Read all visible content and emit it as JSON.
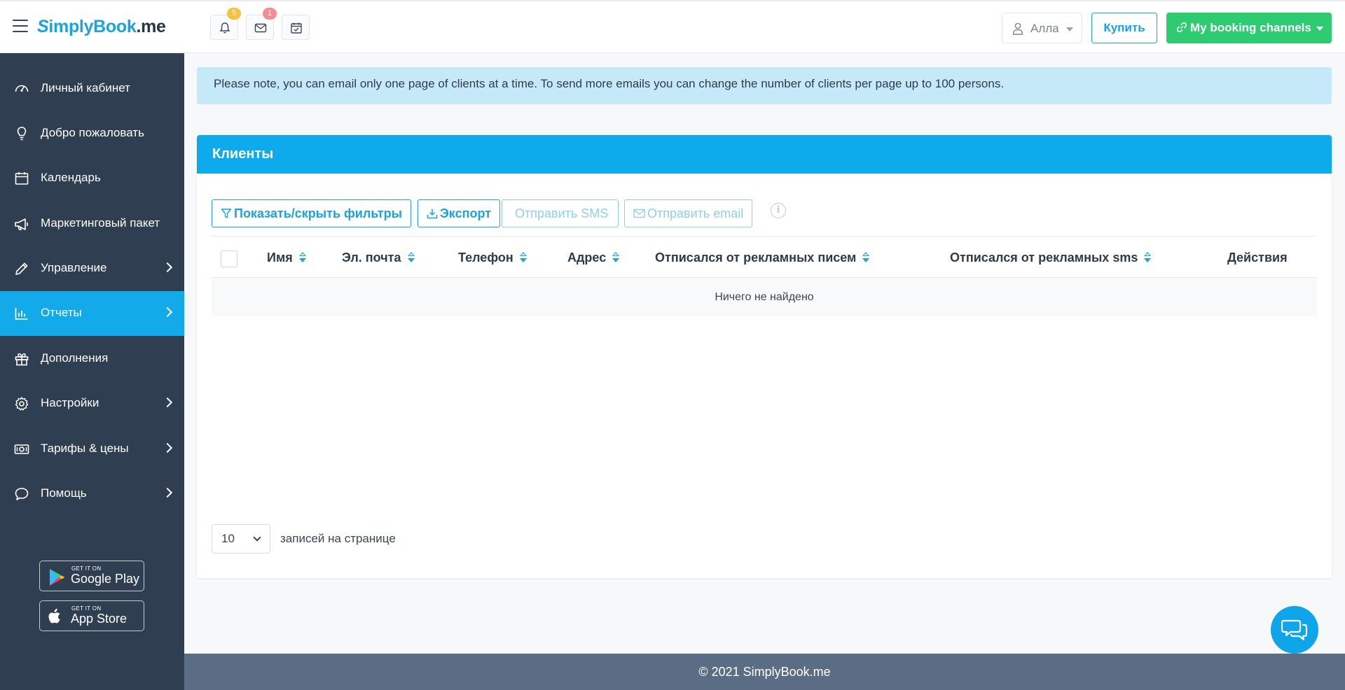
{
  "header": {
    "logo_s": "S",
    "logo_brand": "implyBook",
    "logo_tld": ".me",
    "notifications_badge": "5",
    "messages_badge": "1",
    "user_name": "Алла",
    "buy_label": "Купить",
    "channels_label": "My booking channels"
  },
  "sidebar": {
    "items": [
      {
        "label": "Личный кабинет",
        "icon": "dashboard-icon"
      },
      {
        "label": "Добро пожаловать",
        "icon": "lightbulb-icon"
      },
      {
        "label": "Календарь",
        "icon": "calendar-icon"
      },
      {
        "label": "Маркетинговый пакет",
        "icon": "megaphone-icon"
      },
      {
        "label": "Управление",
        "icon": "pencil-icon"
      },
      {
        "label": "Отчеты",
        "icon": "bar-chart-icon"
      },
      {
        "label": "Дополнения",
        "icon": "gift-icon"
      },
      {
        "label": "Настройки",
        "icon": "gear-icon"
      },
      {
        "label": "Тарифы & цены",
        "icon": "money-icon"
      },
      {
        "label": "Помощь",
        "icon": "chat-bubble-icon"
      }
    ],
    "active_item": "Отчеты",
    "google_play_small": "GET IT ON",
    "google_play_big": "Google Play",
    "app_store_small": "GET IT ON",
    "app_store_big": "App Store"
  },
  "alert": {
    "text": "Please note, you can email only one page of clients at a time. To send more emails you can change the number of clients per page up to 100 persons."
  },
  "panel": {
    "title": "Клиенты",
    "toolbar": {
      "filters": "Показать/скрыть фильтры",
      "export": "Экспорт",
      "send_sms": "Отправить SMS",
      "send_email": "Отправить email"
    },
    "columns": {
      "name": "Имя",
      "email": "Эл. почта",
      "phone": "Телефон",
      "address": "Адрес",
      "unsub_email": "Отписался от рекламных писем",
      "unsub_sms": "Отписался от рекламных sms",
      "actions": "Действия"
    },
    "empty_text": "Ничего не найдено",
    "per_page_value": "10",
    "per_page_label": "записей на странице"
  },
  "footer": {
    "text": "© 2021 SimplyBook.me"
  },
  "colors": {
    "accent": "#0dabeb",
    "sidebar_bg": "#2f3e51",
    "green": "#2ecc71"
  }
}
